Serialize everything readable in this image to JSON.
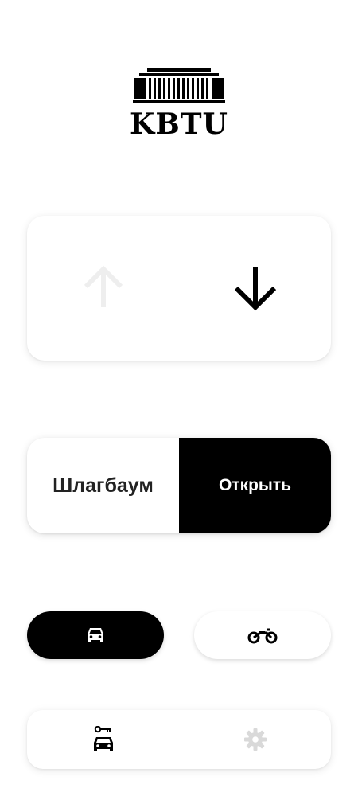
{
  "logo": {
    "text": "KBTU",
    "icon": "building-icon"
  },
  "direction": {
    "up": {
      "icon": "arrow-up-icon",
      "state": "inactive",
      "color": "#eeeeee"
    },
    "down": {
      "icon": "arrow-down-icon",
      "state": "active",
      "color": "#000000"
    }
  },
  "barrier": {
    "label": "Шлагбаум",
    "open_label": "Открыть"
  },
  "vehicle": {
    "car": {
      "icon": "car-icon",
      "selected": true
    },
    "motorcycle": {
      "icon": "motorcycle-icon",
      "selected": false
    }
  },
  "nav": {
    "items": [
      {
        "icon": "parking-key-icon",
        "active": true
      },
      {
        "icon": "gear-icon",
        "active": false
      }
    ]
  },
  "colors": {
    "accent": "#000000",
    "inactive": "#d9d9d9",
    "background": "#ffffff"
  }
}
